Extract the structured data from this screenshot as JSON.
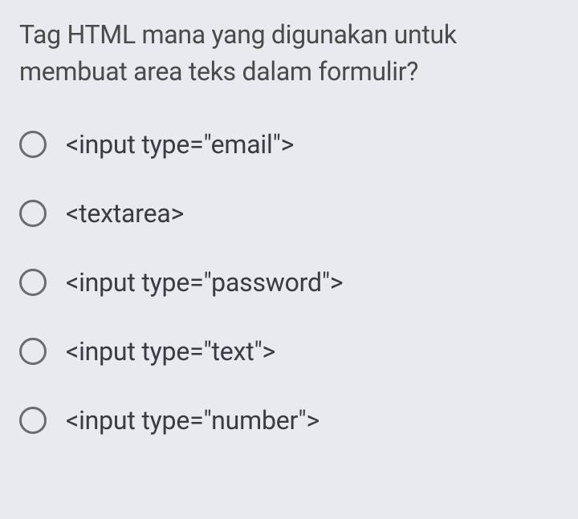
{
  "question": {
    "text": "Tag HTML mana yang digunakan untuk membuat area teks dalam formulir?"
  },
  "options": [
    {
      "label": "<input type=\"email\">"
    },
    {
      "label": "<textarea>"
    },
    {
      "label": "<input type=\"password\">"
    },
    {
      "label": "<input type=\"text\">"
    },
    {
      "label": "<input type=\"number\">"
    }
  ]
}
